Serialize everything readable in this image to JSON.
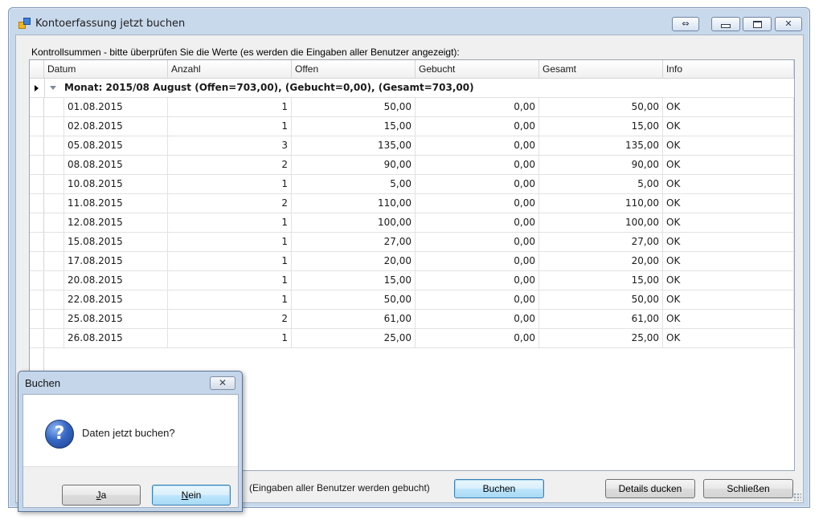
{
  "window": {
    "title": "Kontoerfassung jetzt buchen",
    "swap_glyph": "⇔",
    "close_glyph": "✕"
  },
  "hint": "Kontrollsummen - bitte überprüfen Sie die Werte (es werden die Eingaben aller Benutzer angezeigt):",
  "grid": {
    "columns": [
      "Datum",
      "Anzahl",
      "Offen",
      "Gebucht",
      "Gesamt",
      "Info"
    ],
    "group_label": "Monat: 2015/08 August (Offen=703,00), (Gebucht=0,00), (Gesamt=703,00)",
    "rows": [
      [
        "01.08.2015",
        "1",
        "50,00",
        "0,00",
        "50,00",
        "OK"
      ],
      [
        "02.08.2015",
        "1",
        "15,00",
        "0,00",
        "15,00",
        "OK"
      ],
      [
        "05.08.2015",
        "3",
        "135,00",
        "0,00",
        "135,00",
        "OK"
      ],
      [
        "08.08.2015",
        "2",
        "90,00",
        "0,00",
        "90,00",
        "OK"
      ],
      [
        "10.08.2015",
        "1",
        "5,00",
        "0,00",
        "5,00",
        "OK"
      ],
      [
        "11.08.2015",
        "2",
        "110,00",
        "0,00",
        "110,00",
        "OK"
      ],
      [
        "12.08.2015",
        "1",
        "100,00",
        "0,00",
        "100,00",
        "OK"
      ],
      [
        "15.08.2015",
        "1",
        "27,00",
        "0,00",
        "27,00",
        "OK"
      ],
      [
        "17.08.2015",
        "1",
        "20,00",
        "0,00",
        "20,00",
        "OK"
      ],
      [
        "20.08.2015",
        "1",
        "15,00",
        "0,00",
        "15,00",
        "OK"
      ],
      [
        "22.08.2015",
        "1",
        "50,00",
        "0,00",
        "50,00",
        "OK"
      ],
      [
        "25.08.2015",
        "2",
        "61,00",
        "0,00",
        "61,00",
        "OK"
      ],
      [
        "26.08.2015",
        "1",
        "25,00",
        "0,00",
        "25,00",
        "OK"
      ]
    ]
  },
  "footer": {
    "note": "(Eingaben aller Benutzer werden gebucht)",
    "buchen_label": "Buchen",
    "details_label": "Details ducken",
    "close_label": "Schließen"
  },
  "dialog": {
    "title": "Buchen",
    "close_glyph": "✕",
    "icon_glyph": "?",
    "message": "Daten jetzt buchen?",
    "ja_mnemonic": "J",
    "ja_rest": "a",
    "nein_mnemonic": "N",
    "nein_rest": "ein"
  },
  "icons": {
    "app": "app-window-icon",
    "question": "question-icon"
  }
}
